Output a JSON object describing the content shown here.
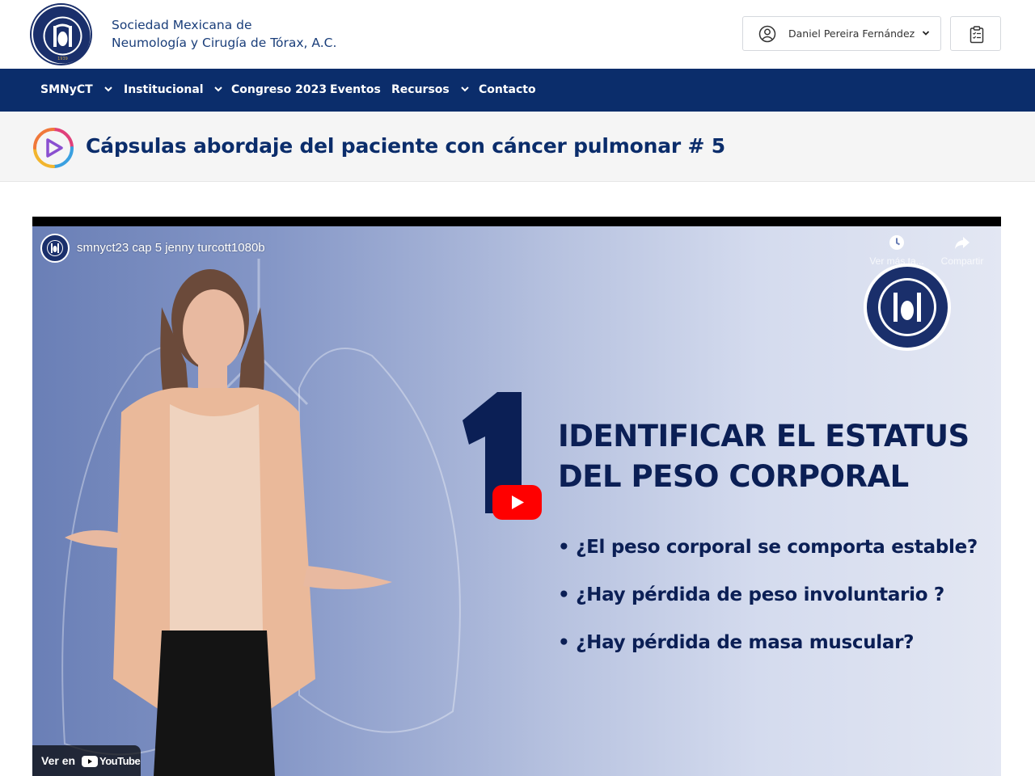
{
  "header": {
    "org_line1": "Sociedad Mexicana de",
    "org_line2": "Neumología y Cirugía de Tórax, A.C.",
    "user_name": "Daniel Pereira Fernández",
    "icons": {
      "logo": "society-seal-logo",
      "user": "user-circle-icon",
      "dropdown": "chevron-down-icon",
      "clipboard": "clipboard-list-icon"
    }
  },
  "nav": {
    "items": [
      {
        "label": "SMNyCT",
        "has_dropdown": true
      },
      {
        "label": "Institucional",
        "has_dropdown": true
      },
      {
        "label": "Congreso 2023",
        "has_dropdown": false
      },
      {
        "label": "Eventos",
        "has_dropdown": false
      },
      {
        "label": "Recursos",
        "has_dropdown": true
      },
      {
        "label": "Contacto",
        "has_dropdown": false
      }
    ]
  },
  "page": {
    "title": "Cápsulas abordaje del paciente con cáncer pulmonar # 5",
    "title_icon": "video-capsule-icon"
  },
  "video": {
    "title": "smnyct23 cap 5 jenny turcott1080b",
    "watch_later": "Ver más ta...",
    "share": "Compartir",
    "watch_on": "Ver en",
    "platform": "YouTube",
    "slide": {
      "number": "1",
      "heading_line1": "IDENTIFICAR EL ESTATUS",
      "heading_line2": "DEL PESO CORPORAL",
      "bullets": [
        "• ¿El peso corporal se comporta estable?",
        "• ¿Hay pérdida de peso involuntario ?",
        "• ¿Hay pérdida de masa muscular?"
      ]
    }
  },
  "colors": {
    "navy": "#0b2d6b",
    "title_band": "#f5f5f5",
    "youtube_red": "#ff0000",
    "slide_text": "#0b1f55"
  }
}
